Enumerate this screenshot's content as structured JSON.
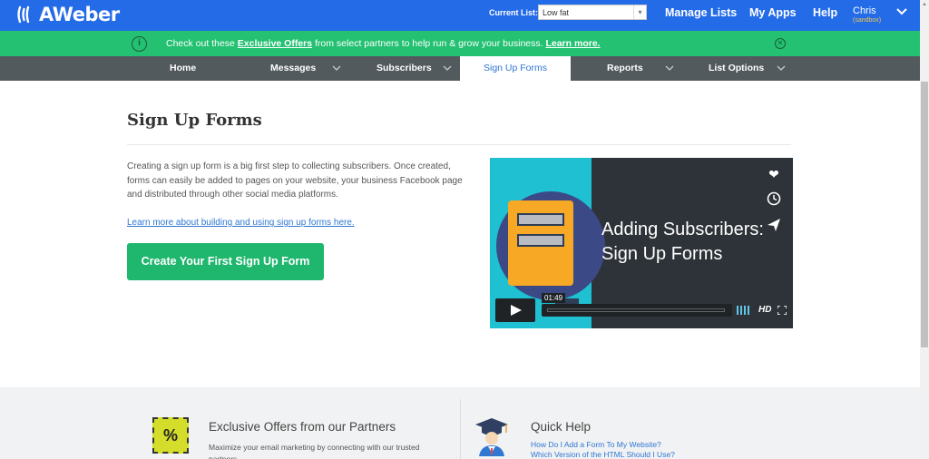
{
  "app": {
    "logo_text": "AWeber"
  },
  "topbar": {
    "current_list_label": "Current List:",
    "current_list_value": "Low fat",
    "links": [
      "Manage Lists",
      "My Apps",
      "Help"
    ],
    "user_name": "Chris",
    "user_sub": "(sandbox)"
  },
  "offer_bar": {
    "text_before": "Check out these ",
    "link1": "Exclusive Offers",
    "text_after": " from select partners to help run & grow your business. ",
    "link2": "Learn more."
  },
  "nav": {
    "items": [
      {
        "label": "Home",
        "has_dropdown": false
      },
      {
        "label": "Messages",
        "has_dropdown": true
      },
      {
        "label": "Subscribers",
        "has_dropdown": true
      },
      {
        "label": "Sign Up Forms",
        "has_dropdown": false,
        "active": true
      },
      {
        "label": "Reports",
        "has_dropdown": true
      },
      {
        "label": "List Options",
        "has_dropdown": true
      }
    ]
  },
  "main": {
    "title": "Sign Up Forms",
    "intro": "Creating a sign up form is a big first step to collecting subscribers. Once created, forms can easily be added to pages on your website, your business Facebook page and distributed through other social media platforms.",
    "learn_link": "Learn more about building and using sign up forms here.",
    "cta_label": "Create Your First Sign Up Form"
  },
  "video": {
    "title_line1": "Adding Subscribers:",
    "title_line2": "Sign Up Forms",
    "time": "01:49",
    "quality": "HD",
    "side_icons": [
      "heart-icon",
      "clock-icon",
      "send-icon"
    ]
  },
  "bottom": {
    "offers_title": "Exclusive Offers from our Partners",
    "offers_desc": "Maximize your email marketing by connecting with our trusted partners.",
    "pct_symbol": "%",
    "quick_help_title": "Quick Help",
    "quick_help_links": [
      "How Do I Add a Form To My Website?",
      "Which Version of the HTML Should I Use?"
    ]
  },
  "colors": {
    "topbar": "#246be8",
    "offer_bar": "#23c171",
    "nav": "#525a5e",
    "cta": "#1fb66d",
    "link": "#2f77d3"
  }
}
